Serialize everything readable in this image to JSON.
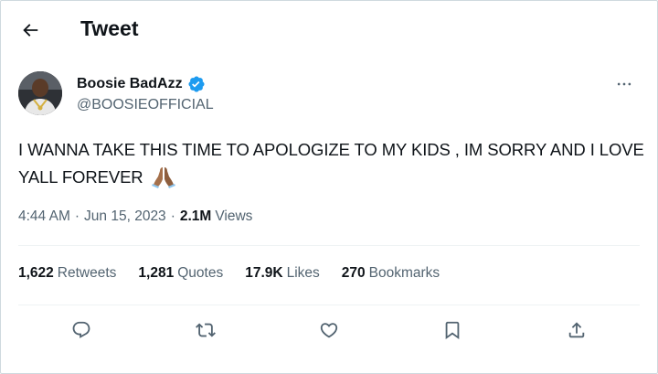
{
  "header": {
    "title": "Tweet",
    "back_icon": "arrow-left-icon"
  },
  "author": {
    "display_name": "Boosie BadAzz",
    "handle": "@BOOSIEOFFICIAL",
    "verified": true,
    "verified_color": "#1d9bf0",
    "more_icon": "more-horizontal-icon"
  },
  "tweet": {
    "text": "I WANNA TAKE THIS TIME TO APOLOGIZE TO MY KIDS , IM SORRY AND I LOVE YALL FOREVER",
    "emoji": "folded-hands-emoji"
  },
  "meta": {
    "time": "4:44 AM",
    "separator": "·",
    "date": "Jun 15, 2023",
    "views_count": "2.1M",
    "views_label": "Views"
  },
  "stats": [
    {
      "count": "1,622",
      "label": "Retweets"
    },
    {
      "count": "1,281",
      "label": "Quotes"
    },
    {
      "count": "17.9K",
      "label": "Likes"
    },
    {
      "count": "270",
      "label": "Bookmarks"
    }
  ],
  "actions": {
    "reply_icon": "reply-icon",
    "retweet_icon": "retweet-icon",
    "like_icon": "heart-icon",
    "bookmark_icon": "bookmark-icon",
    "share_icon": "share-icon"
  },
  "colors": {
    "text": "#0f1419",
    "secondary": "#536471",
    "border": "#eff3f4",
    "accent": "#1d9bf0"
  }
}
